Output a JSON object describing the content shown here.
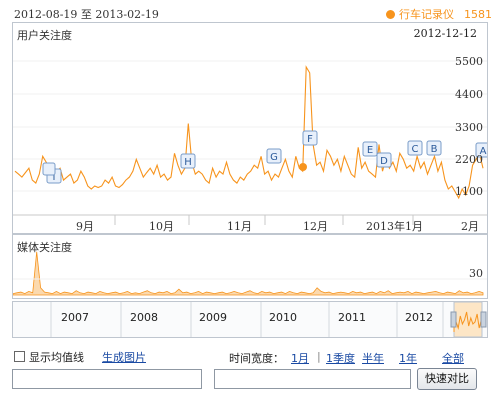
{
  "header": {
    "date_range": "2012-08-19 至 2013-02-19",
    "keyword": "行车记录仪",
    "value": "1581"
  },
  "user_chart": {
    "label": "用户关注度",
    "current_date": "2012-12-12",
    "yticks": [
      "5500",
      "4400",
      "3300",
      "2200",
      "1100"
    ],
    "xticks": [
      "9月",
      "10月",
      "11月",
      "12月",
      "2013年1月",
      "2月"
    ],
    "events": [
      "I",
      "H",
      "G",
      "F",
      "E",
      "D",
      "C",
      "B",
      "A"
    ],
    "series": [
      1800,
      1700,
      1600,
      1750,
      1900,
      1500,
      1400,
      1700,
      2300,
      2100,
      1950,
      2000,
      1800,
      1900,
      1500,
      1600,
      1700,
      1400,
      1500,
      1800,
      1600,
      1300,
      1200,
      1300,
      1250,
      1300,
      1500,
      1400,
      1600,
      1300,
      1250,
      1350,
      1500,
      1600,
      1800,
      2200,
      1900,
      1600,
      1750,
      1900,
      1700,
      2000,
      1600,
      1700,
      1500,
      1600,
      2400,
      2000,
      1700,
      1900,
      3400,
      2100,
      1700,
      1800,
      1700,
      1500,
      1400,
      1900,
      1600,
      1800,
      1700,
      2100,
      1700,
      1500,
      1400,
      1600,
      1500,
      1700,
      1800,
      2000,
      1900,
      2300,
      1700,
      1800,
      1500,
      1700,
      1600,
      1900,
      2200,
      1800,
      1600,
      2300,
      1900,
      1800,
      5300,
      5100,
      2700,
      2000,
      2100,
      1800,
      2500,
      2300,
      2000,
      2200,
      1800,
      2300,
      2000,
      1700,
      1600,
      2600,
      1900,
      2100,
      1800,
      1700,
      1600,
      2700,
      1800,
      2200,
      1900,
      2100,
      1800,
      2400,
      2200,
      1900,
      2000,
      1800,
      2300,
      1900,
      2100,
      1700,
      2000,
      2300,
      1800,
      2100,
      1500,
      1200,
      1300,
      1100,
      900,
      1200,
      1000,
      1300,
      2000,
      2200,
      2400,
      1900
    ]
  },
  "media_chart": {
    "label": "媒体关注度",
    "ytick": "30",
    "series": [
      2,
      3,
      4,
      2,
      5,
      3,
      60,
      10,
      4,
      3,
      2,
      5,
      2,
      4,
      3,
      2,
      6,
      3,
      2,
      4,
      3,
      2,
      5,
      3,
      2,
      3,
      4,
      2,
      3,
      5,
      2,
      3,
      2,
      4,
      6,
      3,
      2,
      4,
      3,
      5,
      2,
      3,
      8,
      3,
      4,
      2,
      3,
      5,
      2,
      4,
      3,
      2,
      3,
      4,
      2,
      3,
      5,
      3,
      2,
      4,
      6,
      3,
      2,
      5,
      3,
      4,
      2,
      3,
      4,
      2,
      5,
      3,
      2,
      4,
      3,
      2,
      3,
      10,
      5,
      3,
      4,
      2,
      3,
      4,
      3,
      2,
      5,
      3,
      4,
      2,
      3,
      4,
      2,
      5,
      3,
      6,
      2,
      3,
      4,
      3,
      5,
      2,
      4,
      3,
      2,
      3,
      4,
      5,
      3,
      2,
      4,
      3,
      2,
      6,
      3,
      4,
      2,
      3,
      5,
      3
    ]
  },
  "timeline": {
    "years": [
      "2007",
      "2008",
      "2009",
      "2010",
      "2011",
      "2012"
    ]
  },
  "controls": {
    "show_average_label": "显示均值线",
    "generate_image_label": "生成图片",
    "time_width_label": "时间宽度：",
    "periods": [
      "1月",
      "1季度",
      "半年",
      "1年",
      "全部"
    ],
    "compare_button": "快速对比",
    "input1_value": "",
    "input2_value": ""
  },
  "colors": {
    "accent": "#f7941d",
    "link": "#1a4aa3",
    "border": "#bfc6cf"
  }
}
